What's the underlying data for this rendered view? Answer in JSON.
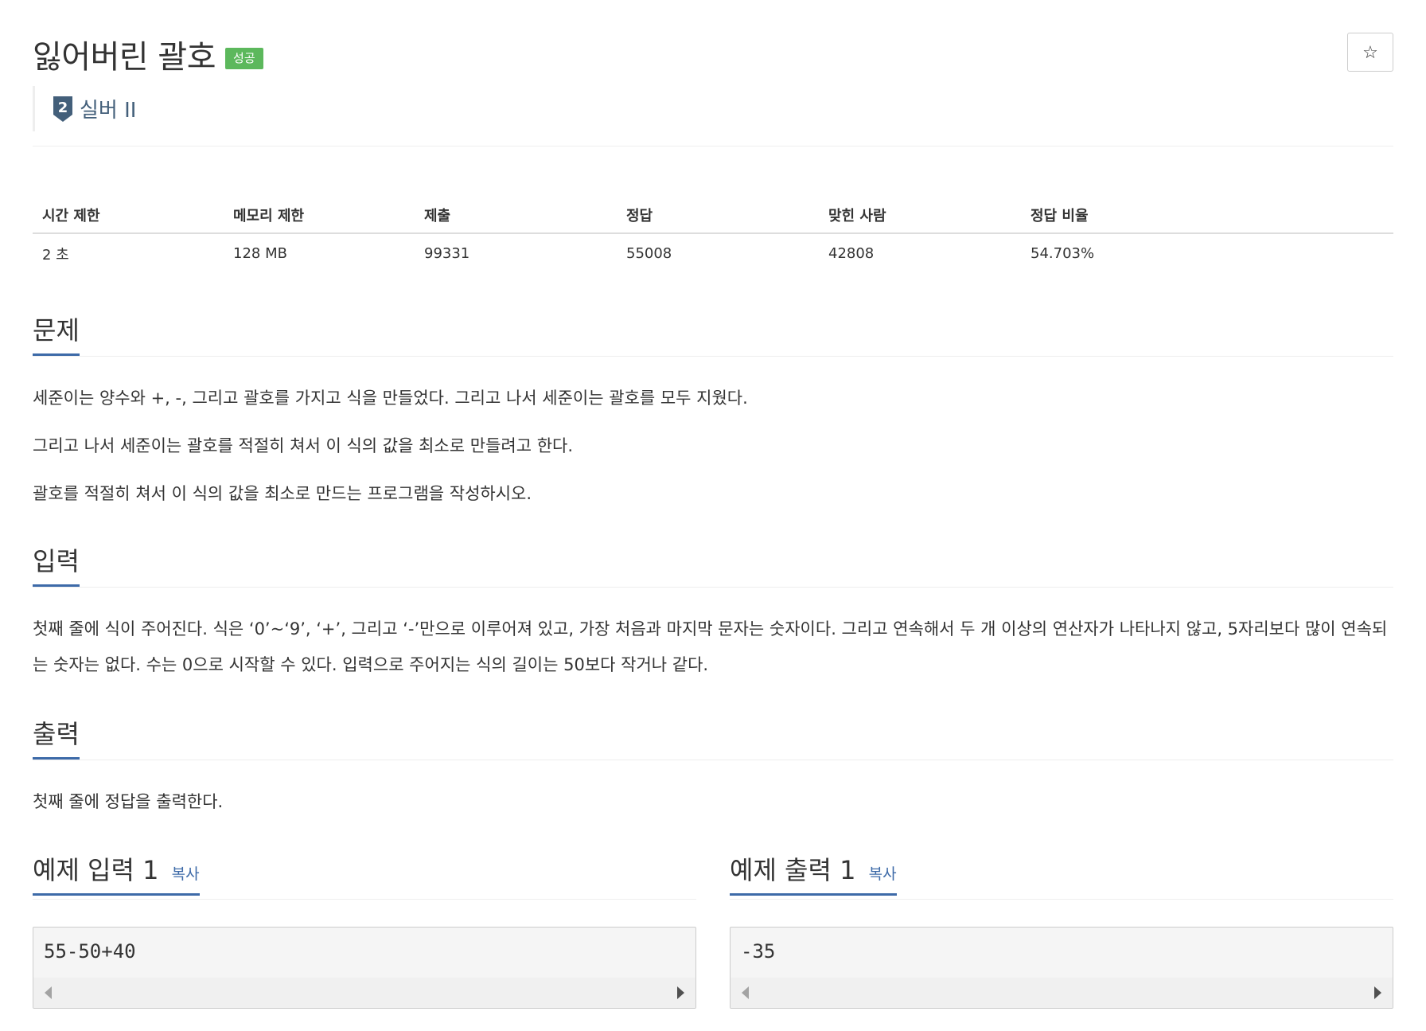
{
  "problem": {
    "title": "잃어버린 괄호",
    "status_badge": "성공",
    "tier_number": "2",
    "tier_label": "실버 II",
    "star_glyph": "☆"
  },
  "info": {
    "headers": [
      "시간 제한",
      "메모리 제한",
      "제출",
      "정답",
      "맞힌 사람",
      "정답 비율"
    ],
    "values": [
      "2 초",
      "128 MB",
      "99331",
      "55008",
      "42808",
      "54.703%"
    ]
  },
  "sections": {
    "description": {
      "title": "문제",
      "paragraphs": [
        "세준이는 양수와 +, -, 그리고 괄호를 가지고 식을 만들었다. 그리고 나서 세준이는 괄호를 모두 지웠다.",
        "그리고 나서 세준이는 괄호를 적절히 쳐서 이 식의 값을 최소로 만들려고 한다.",
        "괄호를 적절히 쳐서 이 식의 값을 최소로 만드는 프로그램을 작성하시오."
      ]
    },
    "input": {
      "title": "입력",
      "paragraphs": [
        "첫째 줄에 식이 주어진다. 식은 ‘0’~‘9’, ‘+’, 그리고 ‘-’만으로 이루어져 있고, 가장 처음과 마지막 문자는 숫자이다. 그리고 연속해서 두 개 이상의 연산자가 나타나지 않고, 5자리보다 많이 연속되는 숫자는 없다. 수는 0으로 시작할 수 있다. 입력으로 주어지는 식의 길이는 50보다 작거나 같다."
      ]
    },
    "output": {
      "title": "출력",
      "paragraphs": [
        "첫째 줄에 정답을 출력한다."
      ]
    }
  },
  "samples": {
    "input": {
      "title": "예제 입력 1",
      "copy_label": "복사",
      "content": "55-50+40"
    },
    "output": {
      "title": "예제 출력 1",
      "copy_label": "복사",
      "content": "-35"
    }
  },
  "colors": {
    "badge_success": "#5cb85c",
    "tier_silver": "#435f7a",
    "accent_underline": "#3d6aa8"
  }
}
